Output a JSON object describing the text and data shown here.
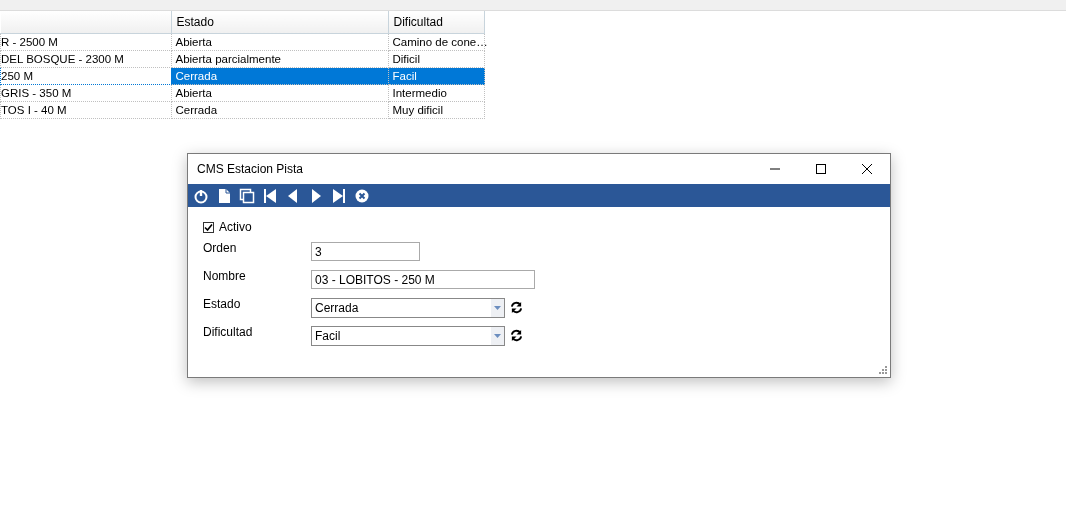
{
  "table": {
    "columns": [
      {},
      {
        "label": "Estado"
      },
      {
        "label": "Dificultad"
      }
    ],
    "rows": [
      {
        "cells": [
          "R - 2500 M",
          "Abierta",
          "Camino de cone…"
        ],
        "selected": false
      },
      {
        "cells": [
          "DEL BOSQUE - 2300 M",
          "Abierta parcialmente",
          "Dificil"
        ],
        "selected": false
      },
      {
        "cells": [
          "250 M",
          "Cerrada",
          "Facil"
        ],
        "selected": true
      },
      {
        "cells": [
          "GRIS - 350 M",
          "Abierta",
          "Intermedio"
        ],
        "selected": false
      },
      {
        "cells": [
          "TOS I - 40 M",
          "Cerrada",
          "Muy dificil"
        ],
        "selected": false
      }
    ]
  },
  "dialog": {
    "title": "CMS Estacion Pista",
    "toolbar": [
      {
        "kind": "power"
      },
      {
        "kind": "new"
      },
      {
        "kind": "copy"
      },
      {
        "kind": "first"
      },
      {
        "kind": "prev"
      },
      {
        "kind": "next"
      },
      {
        "kind": "last"
      },
      {
        "kind": "cancel"
      }
    ],
    "checkbox": {
      "label": "Activo",
      "checked": true
    },
    "fields": [
      {
        "kind": "number",
        "label": "Orden",
        "value": "3"
      },
      {
        "kind": "text",
        "label": "Nombre",
        "value": "03 - LOBITOS - 250 M"
      },
      {
        "kind": "combo",
        "label": "Estado",
        "value": "Cerrada"
      },
      {
        "kind": "combo",
        "label": "Dificultad",
        "value": "Facil"
      }
    ]
  }
}
